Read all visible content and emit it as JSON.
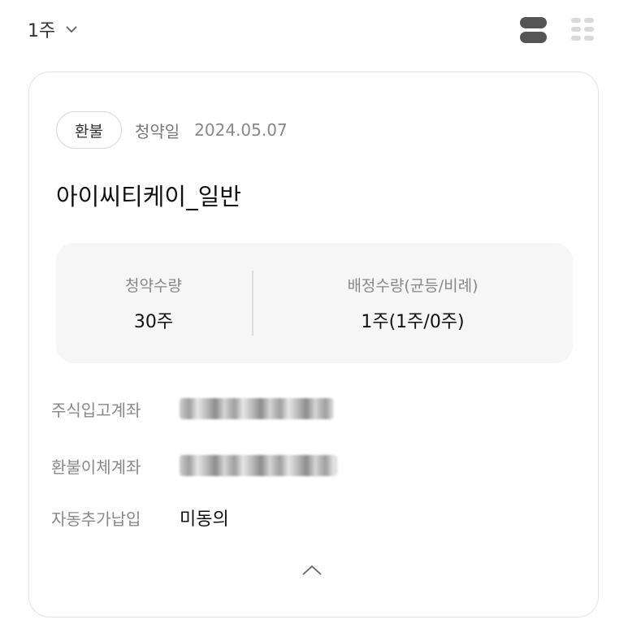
{
  "filter": {
    "label": "1주"
  },
  "card": {
    "badge": "환불",
    "subscription_date_label": "청약일",
    "subscription_date": "2024.05.07",
    "stock_name": "아이씨티케이_일반",
    "summary": {
      "subscribe_qty_label": "청약수량",
      "subscribe_qty_value": "30주",
      "allot_qty_label": "배정수량(균등/비례)",
      "allot_qty_value": "1주(1주/0주)"
    },
    "details": [
      {
        "label": "주식입고계좌",
        "value": "",
        "masked": true
      },
      {
        "label": "환불이체계좌",
        "value": "",
        "masked": true
      },
      {
        "label": "자동추가납입",
        "value": "미동의",
        "masked": false
      }
    ]
  },
  "icons": {
    "filter_dropdown": "chevron-down-icon",
    "list_view": "list-view-icon",
    "grid_view": "grid-view-icon",
    "collapse": "chevron-up-icon"
  },
  "colors": {
    "active_icon": "#555555",
    "inactive_icon": "#d9d9d9",
    "summary_bg": "#f6f6f6",
    "card_border": "#e2e2e2"
  }
}
